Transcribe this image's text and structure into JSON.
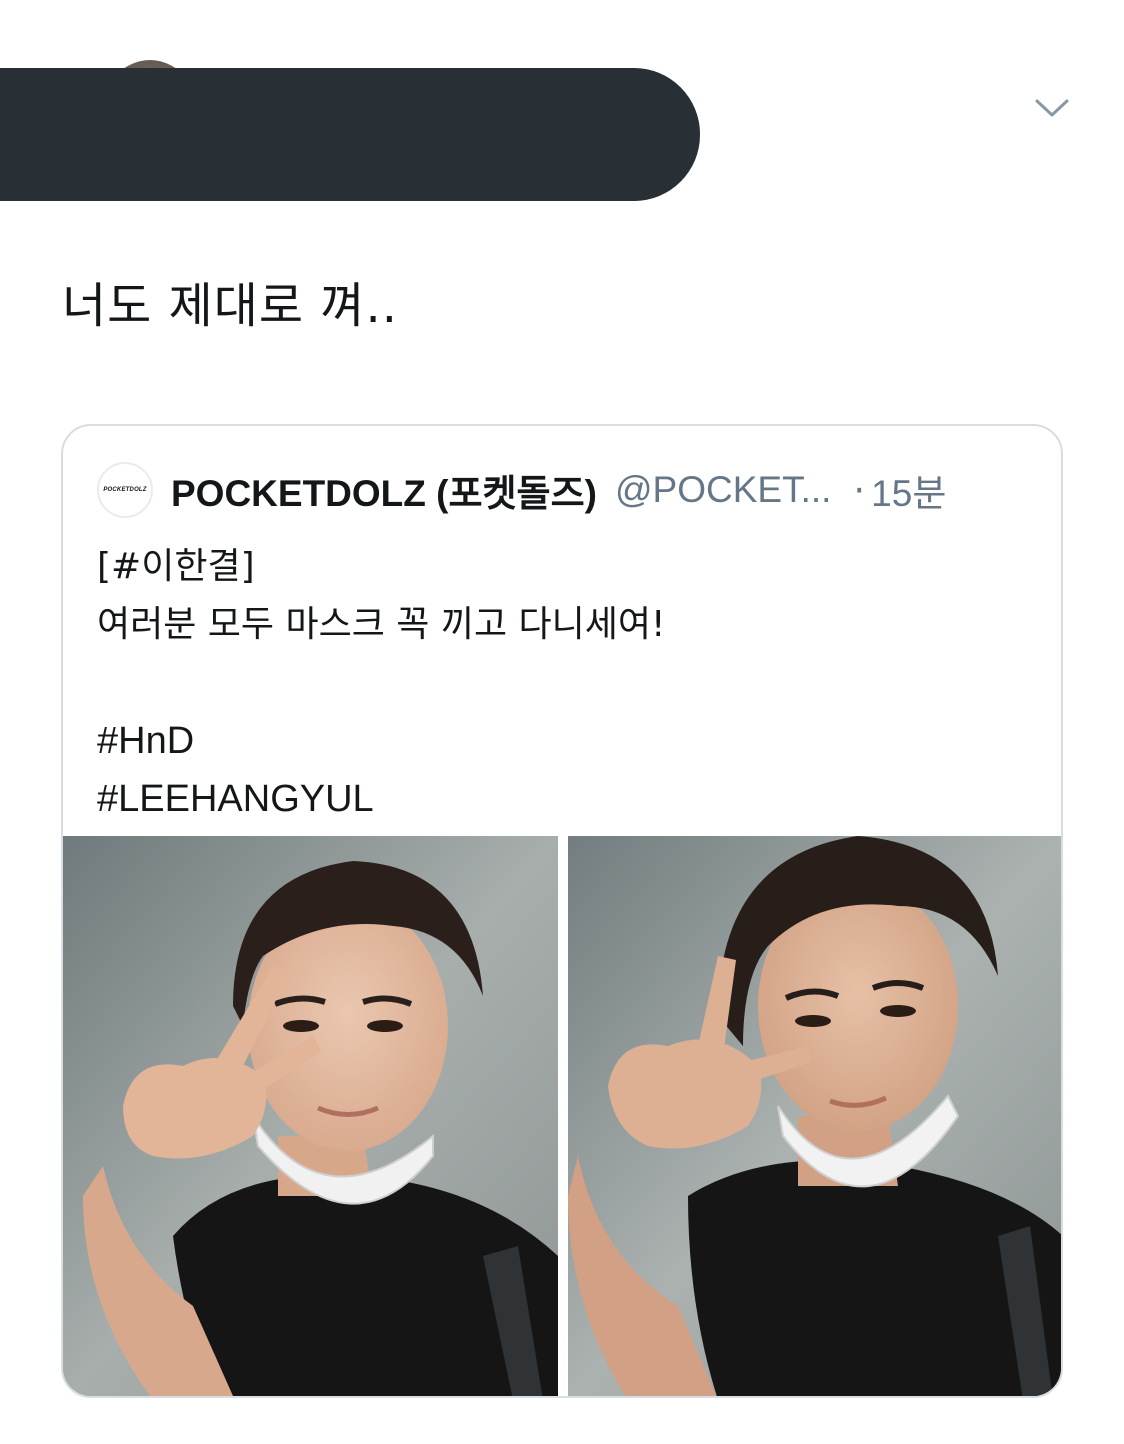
{
  "tweet": {
    "text": "너도 제대로 껴.."
  },
  "quoted": {
    "avatar_logo_text": "POCKETDOLZ",
    "author_name": "POCKETDOLZ (포켓돌즈)",
    "author_handle": "@POCKET...",
    "separator": "·",
    "time": "15분",
    "body_lines": [
      "[#이한결]",
      "여러분 모두 마스크 꼭 끼고 다니세여!",
      "",
      "#HnD",
      "#LEEHANGYUL"
    ],
    "photos": [
      {
        "subject": "selfie-peace-sign-mask-on-chin"
      },
      {
        "subject": "selfie-peace-sign-mask-on-chin"
      }
    ]
  },
  "icons": {
    "more": "chevron-down-icon"
  },
  "colors": {
    "redaction": "#293035",
    "secondary_text": "#657786",
    "card_border": "#d6dde3",
    "chevron": "#8899a6"
  }
}
